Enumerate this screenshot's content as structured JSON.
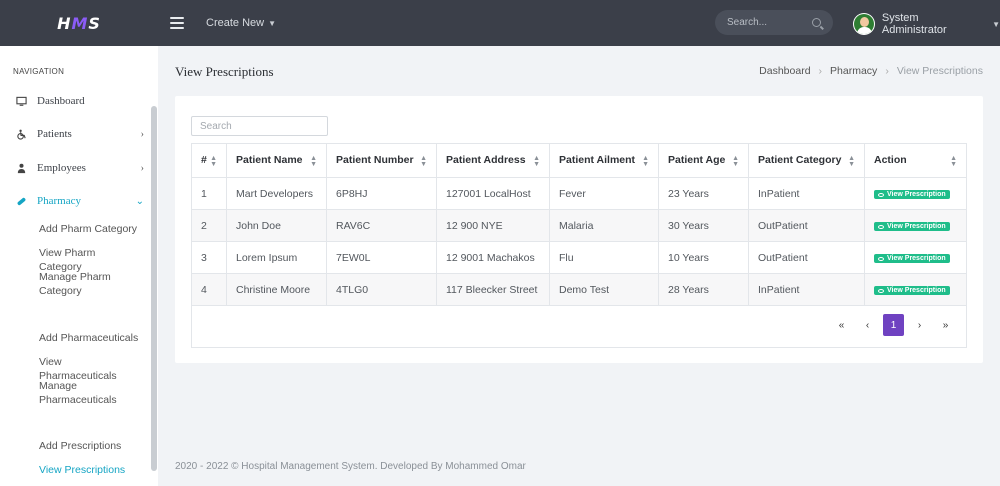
{
  "topbar": {
    "logo": "HMS",
    "create_new": "Create New",
    "search_placeholder": "Search...",
    "user_name": "System Administrator"
  },
  "sidebar": {
    "title": "NAVIGATION",
    "items": [
      {
        "label": "Dashboard"
      },
      {
        "label": "Patients"
      },
      {
        "label": "Employees"
      },
      {
        "label": "Pharmacy"
      }
    ],
    "sub_items": [
      {
        "label": "Add Pharm Category"
      },
      {
        "label": "View Pharm Category"
      },
      {
        "label": "Manage Pharm Category"
      },
      {
        "label": "Add Pharmaceuticals"
      },
      {
        "label": "View Pharmaceuticals"
      },
      {
        "label": "Manage Pharmaceuticals"
      },
      {
        "label": "Add Prescriptions"
      },
      {
        "label": "View Prescriptions"
      }
    ]
  },
  "page": {
    "title": "View Prescriptions",
    "breadcrumb": [
      "Dashboard",
      "Pharmacy",
      "View Prescriptions"
    ]
  },
  "table": {
    "search_placeholder": "Search",
    "columns": [
      "#",
      "Patient Name",
      "Patient Number",
      "Patient Address",
      "Patient Ailment",
      "Patient Age",
      "Patient Category",
      "Action"
    ],
    "rows": [
      {
        "n": "1",
        "name": "Mart Developers",
        "number": "6P8HJ",
        "address": "127001 LocalHost",
        "ailment": "Fever",
        "age": "23 Years",
        "category": "InPatient",
        "action": "View Prescription"
      },
      {
        "n": "2",
        "name": "John Doe",
        "number": "RAV6C",
        "address": "12 900 NYE",
        "ailment": "Malaria",
        "age": "30 Years",
        "category": "OutPatient",
        "action": "View Prescription"
      },
      {
        "n": "3",
        "name": "Lorem Ipsum",
        "number": "7EW0L",
        "address": "12 9001 Machakos",
        "ailment": "Flu",
        "age": "10 Years",
        "category": "OutPatient",
        "action": "View Prescription"
      },
      {
        "n": "4",
        "name": "Christine Moore",
        "number": "4TLG0",
        "address": "117 Bleecker Street",
        "ailment": "Demo Test",
        "age": "28 Years",
        "category": "InPatient",
        "action": "View Prescription"
      }
    ],
    "pagination": {
      "first": "«",
      "prev": "‹",
      "current": "1",
      "next": "›",
      "last": "»"
    }
  },
  "footer": "2020 - 2022 © Hospital Management System. Developed By Mohammed Omar"
}
